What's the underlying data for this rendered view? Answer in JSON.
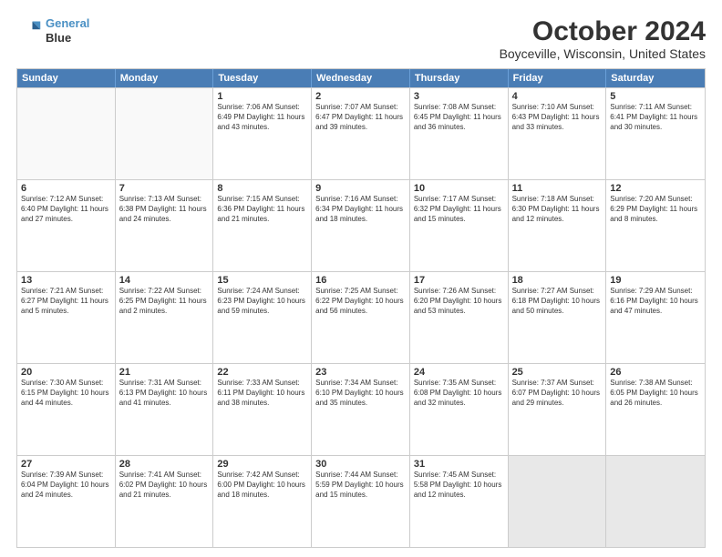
{
  "logo": {
    "line1": "General",
    "line2": "Blue"
  },
  "title": "October 2024",
  "subtitle": "Boyceville, Wisconsin, United States",
  "header_days": [
    "Sunday",
    "Monday",
    "Tuesday",
    "Wednesday",
    "Thursday",
    "Friday",
    "Saturday"
  ],
  "weeks": [
    [
      {
        "day": "",
        "info": "",
        "empty": true
      },
      {
        "day": "",
        "info": "",
        "empty": true
      },
      {
        "day": "1",
        "info": "Sunrise: 7:06 AM\nSunset: 6:49 PM\nDaylight: 11 hours and 43 minutes."
      },
      {
        "day": "2",
        "info": "Sunrise: 7:07 AM\nSunset: 6:47 PM\nDaylight: 11 hours and 39 minutes."
      },
      {
        "day": "3",
        "info": "Sunrise: 7:08 AM\nSunset: 6:45 PM\nDaylight: 11 hours and 36 minutes."
      },
      {
        "day": "4",
        "info": "Sunrise: 7:10 AM\nSunset: 6:43 PM\nDaylight: 11 hours and 33 minutes."
      },
      {
        "day": "5",
        "info": "Sunrise: 7:11 AM\nSunset: 6:41 PM\nDaylight: 11 hours and 30 minutes."
      }
    ],
    [
      {
        "day": "6",
        "info": "Sunrise: 7:12 AM\nSunset: 6:40 PM\nDaylight: 11 hours and 27 minutes."
      },
      {
        "day": "7",
        "info": "Sunrise: 7:13 AM\nSunset: 6:38 PM\nDaylight: 11 hours and 24 minutes."
      },
      {
        "day": "8",
        "info": "Sunrise: 7:15 AM\nSunset: 6:36 PM\nDaylight: 11 hours and 21 minutes."
      },
      {
        "day": "9",
        "info": "Sunrise: 7:16 AM\nSunset: 6:34 PM\nDaylight: 11 hours and 18 minutes."
      },
      {
        "day": "10",
        "info": "Sunrise: 7:17 AM\nSunset: 6:32 PM\nDaylight: 11 hours and 15 minutes."
      },
      {
        "day": "11",
        "info": "Sunrise: 7:18 AM\nSunset: 6:30 PM\nDaylight: 11 hours and 12 minutes."
      },
      {
        "day": "12",
        "info": "Sunrise: 7:20 AM\nSunset: 6:29 PM\nDaylight: 11 hours and 8 minutes."
      }
    ],
    [
      {
        "day": "13",
        "info": "Sunrise: 7:21 AM\nSunset: 6:27 PM\nDaylight: 11 hours and 5 minutes."
      },
      {
        "day": "14",
        "info": "Sunrise: 7:22 AM\nSunset: 6:25 PM\nDaylight: 11 hours and 2 minutes."
      },
      {
        "day": "15",
        "info": "Sunrise: 7:24 AM\nSunset: 6:23 PM\nDaylight: 10 hours and 59 minutes."
      },
      {
        "day": "16",
        "info": "Sunrise: 7:25 AM\nSunset: 6:22 PM\nDaylight: 10 hours and 56 minutes."
      },
      {
        "day": "17",
        "info": "Sunrise: 7:26 AM\nSunset: 6:20 PM\nDaylight: 10 hours and 53 minutes."
      },
      {
        "day": "18",
        "info": "Sunrise: 7:27 AM\nSunset: 6:18 PM\nDaylight: 10 hours and 50 minutes."
      },
      {
        "day": "19",
        "info": "Sunrise: 7:29 AM\nSunset: 6:16 PM\nDaylight: 10 hours and 47 minutes."
      }
    ],
    [
      {
        "day": "20",
        "info": "Sunrise: 7:30 AM\nSunset: 6:15 PM\nDaylight: 10 hours and 44 minutes."
      },
      {
        "day": "21",
        "info": "Sunrise: 7:31 AM\nSunset: 6:13 PM\nDaylight: 10 hours and 41 minutes."
      },
      {
        "day": "22",
        "info": "Sunrise: 7:33 AM\nSunset: 6:11 PM\nDaylight: 10 hours and 38 minutes."
      },
      {
        "day": "23",
        "info": "Sunrise: 7:34 AM\nSunset: 6:10 PM\nDaylight: 10 hours and 35 minutes."
      },
      {
        "day": "24",
        "info": "Sunrise: 7:35 AM\nSunset: 6:08 PM\nDaylight: 10 hours and 32 minutes."
      },
      {
        "day": "25",
        "info": "Sunrise: 7:37 AM\nSunset: 6:07 PM\nDaylight: 10 hours and 29 minutes."
      },
      {
        "day": "26",
        "info": "Sunrise: 7:38 AM\nSunset: 6:05 PM\nDaylight: 10 hours and 26 minutes."
      }
    ],
    [
      {
        "day": "27",
        "info": "Sunrise: 7:39 AM\nSunset: 6:04 PM\nDaylight: 10 hours and 24 minutes."
      },
      {
        "day": "28",
        "info": "Sunrise: 7:41 AM\nSunset: 6:02 PM\nDaylight: 10 hours and 21 minutes."
      },
      {
        "day": "29",
        "info": "Sunrise: 7:42 AM\nSunset: 6:00 PM\nDaylight: 10 hours and 18 minutes."
      },
      {
        "day": "30",
        "info": "Sunrise: 7:44 AM\nSunset: 5:59 PM\nDaylight: 10 hours and 15 minutes."
      },
      {
        "day": "31",
        "info": "Sunrise: 7:45 AM\nSunset: 5:58 PM\nDaylight: 10 hours and 12 minutes."
      },
      {
        "day": "",
        "info": "",
        "empty": true,
        "shaded": true
      },
      {
        "day": "",
        "info": "",
        "empty": true,
        "shaded": true
      }
    ]
  ]
}
